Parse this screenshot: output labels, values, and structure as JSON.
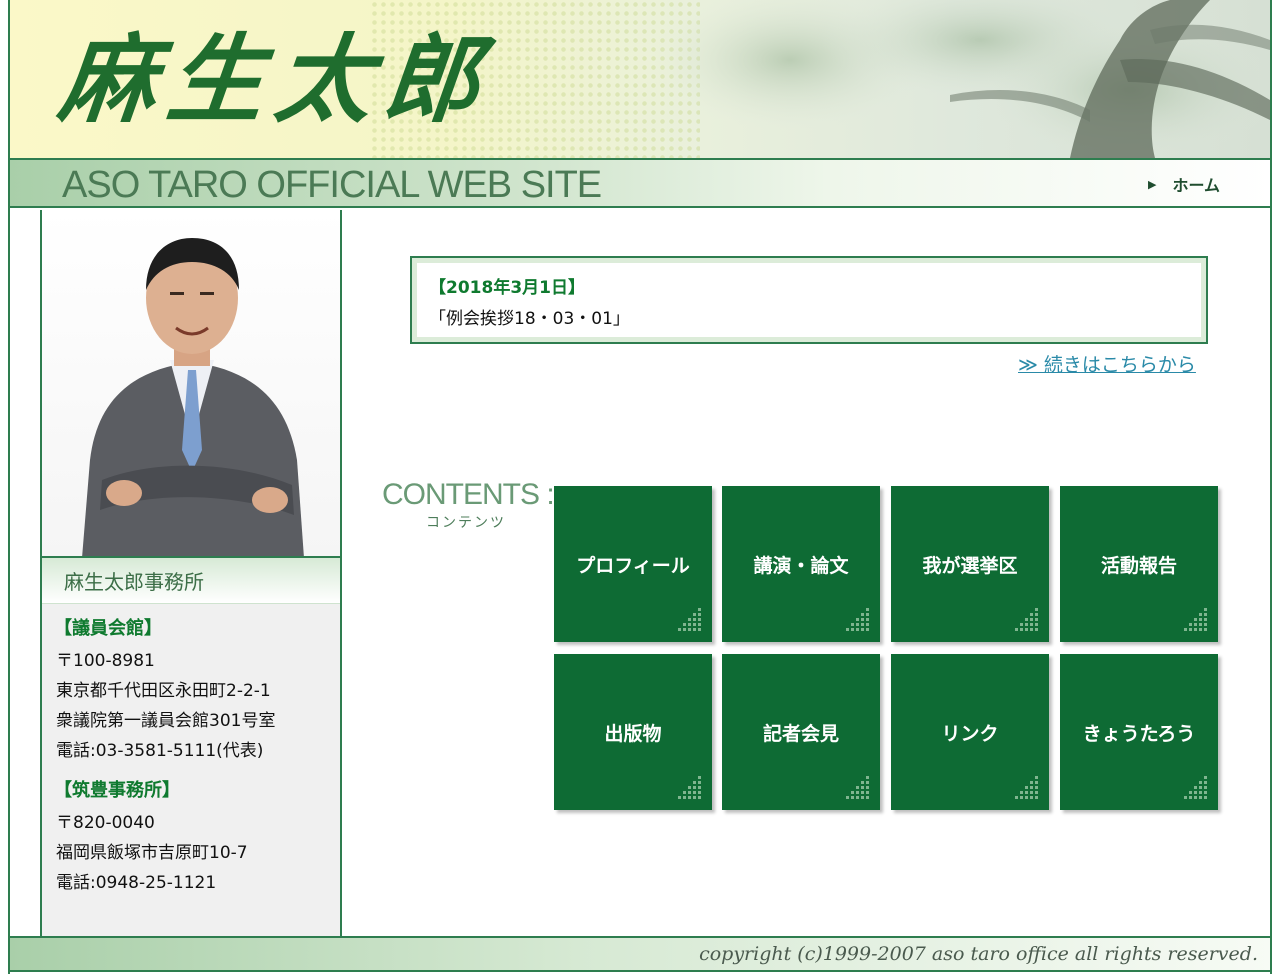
{
  "header": {
    "logo_text": "麻生太郎",
    "site_title": "ASO TARO OFFICIAL WEB SITE",
    "home_label": "ホーム"
  },
  "sidebar": {
    "office_title": "麻生太郎事務所",
    "blocks": [
      {
        "heading": "【議員会館】",
        "lines": [
          "〒100-8981",
          "東京都千代田区永田町2-2-1",
          "衆議院第一議員会館301号室",
          "電話:03-3581-5111(代表)"
        ]
      },
      {
        "heading": "【筑豊事務所】",
        "lines": [
          "〒820-0040",
          "福岡県飯塚市吉原町10-7",
          "電話:0948-25-1121"
        ]
      }
    ]
  },
  "news": {
    "date": "【2018年3月1日】",
    "text": "「例会挨拶18・03・01」",
    "more_label": "≫ 続きはこちらから"
  },
  "contents": {
    "label": "CONTENTS :",
    "sub_label": "コンテンツ",
    "tiles": [
      "プロフィール",
      "講演・論文",
      "我が選挙区",
      "活動報告",
      "出版物",
      "記者会見",
      "リンク",
      "きょうたろう"
    ]
  },
  "footer": {
    "copyright": "copyright (c)1999-2007 aso taro office all rights reserved."
  },
  "colors": {
    "primary_green": "#0e6b34",
    "border_green": "#2e7d4f",
    "link_blue": "#2a8aa8"
  }
}
